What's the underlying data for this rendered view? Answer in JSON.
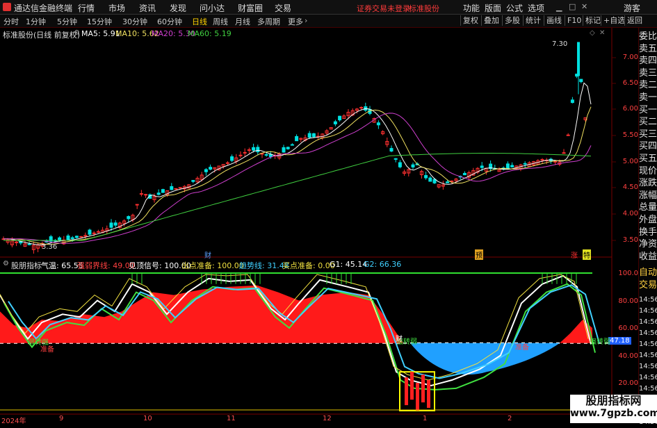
{
  "topbar": {
    "app_title": "通达信金融终端",
    "menu": [
      "行情",
      "市场",
      "资讯",
      "发现",
      "问小达",
      "财富圈",
      "交易"
    ],
    "notice_login": "证券交易未登录",
    "notice_stock": "标准股份",
    "right_menu": [
      "功能",
      "版面",
      "公式",
      "选项"
    ],
    "guest": "游客"
  },
  "periodbar": {
    "periods": [
      "分时",
      "1分钟",
      "5分钟",
      "15分钟",
      "30分钟",
      "60分钟",
      "日线",
      "周线",
      "月线",
      "多周期",
      "更多"
    ],
    "active_period": "日线",
    "right_buttons": [
      "复权",
      "叠加",
      "多股",
      "统计",
      "画线",
      "F10",
      "标记",
      "+自选",
      "返回"
    ]
  },
  "kline_header": {
    "stock_label": "标准股份(日线 前复权)",
    "ma5": "MA5: 5.91",
    "ma10": "MA10: 5.62",
    "ma20": "MA20: 5.30",
    "ma60": "MA60: 5.19",
    "colors": {
      "ma5": "#ffffff",
      "ma10": "#f0e060",
      "ma20": "#d040d0",
      "ma60": "#40d040"
    }
  },
  "price_axis": [
    "7.00",
    "6.50",
    "6.00",
    "5.50",
    "5.00",
    "4.50",
    "4.00",
    "3.50"
  ],
  "price_annotations": {
    "high": "7.30",
    "low": "3.36"
  },
  "event_markers": {
    "cai": "财",
    "yu": "预",
    "zhang": "涨",
    "te": "特"
  },
  "indicator_header": {
    "name": "股朋指标",
    "qiwen": "气温: 65.55",
    "qiangruo": "强弱界线: 49.00",
    "jianding": "见顶信号: 100.00",
    "chudian": "出点准备: 100.00",
    "qushi": "趋势线: 31.48",
    "maidian": "买点准备: 0.00",
    "g1": "G1: 45.14",
    "g2": "G2: 66.36"
  },
  "indicator_axis": [
    "100.0",
    "80.00",
    "60.00",
    "40.00",
    "20.00"
  ],
  "indicator_value_label": "47.18",
  "indicator_annotations": {
    "ruo_jiao_qiang": "弱转强",
    "qiang_jiao_ruo": "强转弱",
    "zhun_bei": "准备",
    "cai": "财"
  },
  "date_axis": [
    "2024年",
    "9",
    "10",
    "11",
    "12",
    "1",
    "2"
  ],
  "side_panel": {
    "upper": [
      "委比",
      "卖五",
      "卖四",
      "卖三",
      "卖二",
      "卖一",
      "买一",
      "买二",
      "买三",
      "买四",
      "买五",
      "现价",
      "涨跌",
      "涨幅",
      "总量",
      "外盘",
      "换手",
      "净资",
      "收益"
    ],
    "mid": [
      "自动",
      "交易"
    ],
    "times": [
      "14:56",
      "14:56",
      "14:56",
      "14:56",
      "14:56",
      "14:56",
      "14:56",
      "14:56",
      "14:56",
      "14:56",
      "14:56",
      "14:56"
    ]
  },
  "watermark": {
    "line1": "股朋指标网",
    "line2": "www.7gpzb.com"
  }
}
